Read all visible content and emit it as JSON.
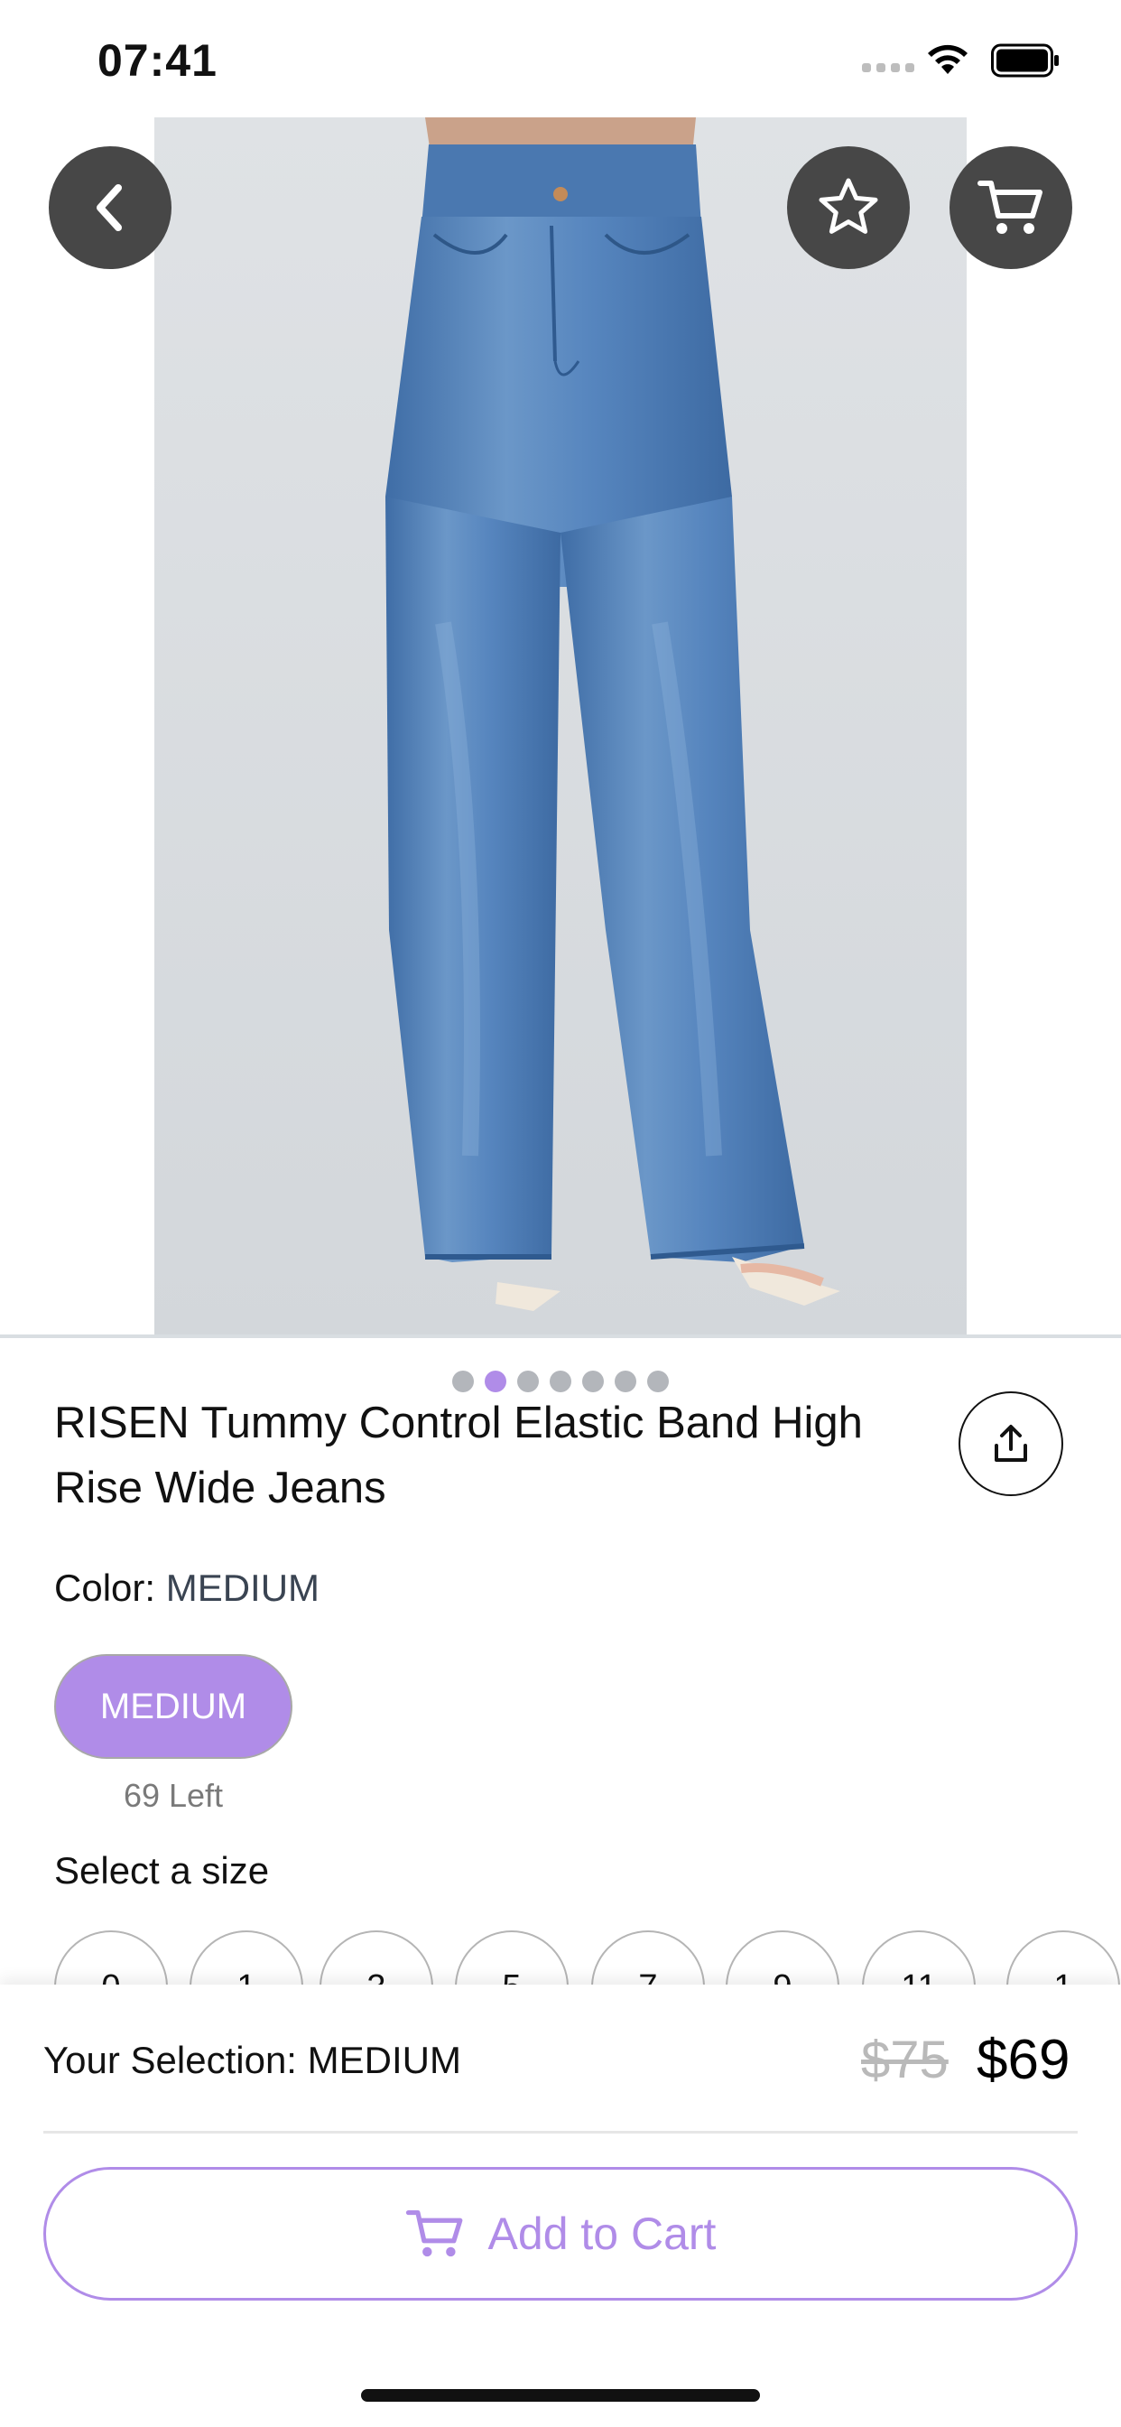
{
  "status_bar": {
    "time": "07:41"
  },
  "product": {
    "title": "RISEN  Tummy Control Elastic Band High Rise Wide Jeans",
    "color_label": "Color: ",
    "color_value": "MEDIUM",
    "swatch_label": "MEDIUM",
    "stock_text": "69 Left",
    "size_label": "Select a size",
    "sizes": [
      "0",
      "1",
      "3",
      "5",
      "7",
      "9",
      "11",
      "1"
    ]
  },
  "gallery": {
    "page_count": 7,
    "active_index": 1
  },
  "bottom_bar": {
    "selection_text": "Your Selection: MEDIUM",
    "old_price": "$75",
    "new_price": "$69",
    "add_to_cart_label": "Add to Cart"
  },
  "colors": {
    "accent": "#b08ce8",
    "dark_button": "#474747",
    "denim": "#4d7db3"
  },
  "icons": [
    "back-arrow-icon",
    "star-icon",
    "cart-icon",
    "share-icon",
    "cart-outline-icon",
    "wifi-icon",
    "battery-icon"
  ]
}
